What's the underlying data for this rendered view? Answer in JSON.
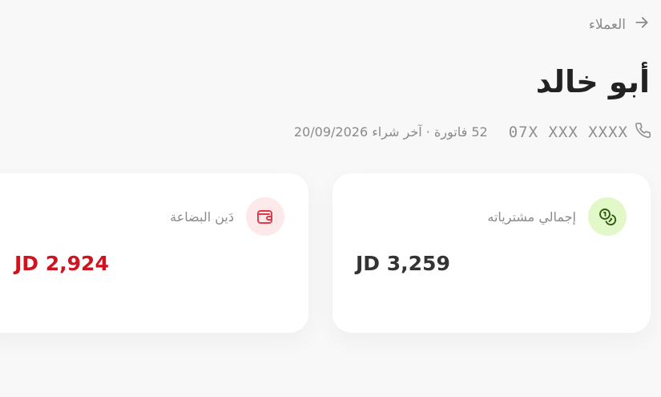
{
  "nav": {
    "back_label": "العملاء",
    "back_icon": "arrow-right-icon"
  },
  "customer": {
    "name": "أبو خالد",
    "phone": "07X XXX XXXX",
    "invoices_and_last_purchase": "52 فاتورة · آخر شراء 20/09/2026"
  },
  "cards": {
    "purchases": {
      "label": "إجمالي مشترياته",
      "value": "JD 3,259",
      "icon": "coins-icon",
      "icon_bg": "#e3f8c8",
      "icon_color": "#2f5d12"
    },
    "debt": {
      "label": "دَين البضاعة",
      "value": "JD 2,924",
      "icon": "wallet-icon",
      "icon_bg": "#fde8ea",
      "icon_color": "#e03a49",
      "value_color": "#d1121f"
    }
  }
}
